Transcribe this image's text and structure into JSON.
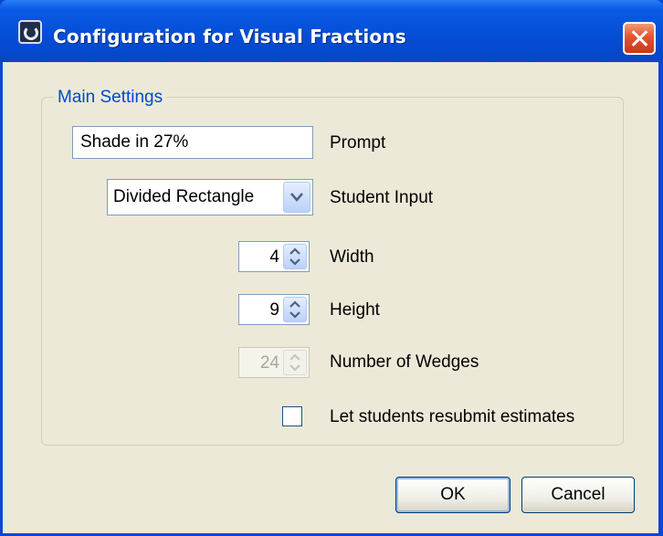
{
  "window": {
    "title": "Configuration for Visual Fractions"
  },
  "main_settings": {
    "group_title": "Main Settings",
    "prompt": {
      "value": "Shade in 27%",
      "label": "Prompt"
    },
    "student_input": {
      "selected": "Divided Rectangle",
      "label": "Student Input"
    },
    "width": {
      "value": "4",
      "label": "Width"
    },
    "height": {
      "value": "9",
      "label": "Height"
    },
    "wedges": {
      "value": "24",
      "label": "Number of Wedges",
      "disabled": true
    },
    "resubmit": {
      "label": "Let students resubmit estimates",
      "checked": false
    }
  },
  "buttons": {
    "ok": "OK",
    "cancel": "Cancel"
  },
  "colors": {
    "title_bar": "#0650d8",
    "dialog_background": "#ece9d8",
    "group_title": "#0046d5",
    "close_button": "#e25530"
  }
}
